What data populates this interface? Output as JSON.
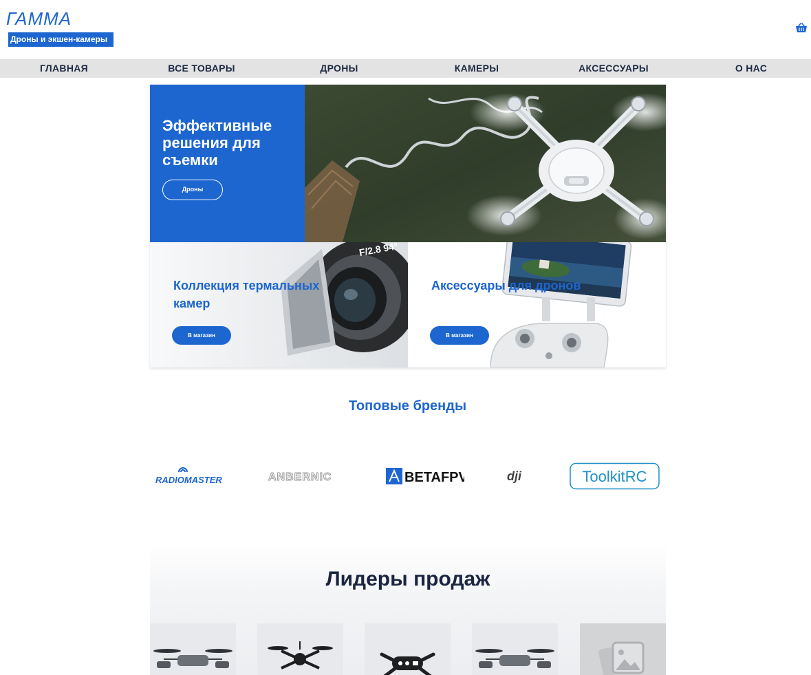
{
  "header": {
    "logo": "ГАММА",
    "tagline": "Дроны и экшен-камеры",
    "cart_icon": "basket-icon"
  },
  "nav": {
    "items": [
      {
        "label": "ГЛАВНАЯ"
      },
      {
        "label": "ВСЕ ТОВАРЫ"
      },
      {
        "label": "ДРОНЫ"
      },
      {
        "label": "КАМЕРЫ"
      },
      {
        "label": "АКСЕССУАРЫ"
      },
      {
        "label": "О НАС"
      }
    ]
  },
  "hero": {
    "title": "Эффективные решения для съемки",
    "button": "Дроны"
  },
  "cards": [
    {
      "title": "Коллекция термальных камер",
      "button": "В магазин"
    },
    {
      "title": "Аксессуары для дронов",
      "button": "В магазин"
    }
  ],
  "brands": {
    "title": "Топовые бренды",
    "logos": [
      "RADIOMASTER",
      "ANBERNIC",
      "BETAFPV",
      "dji",
      "ToolkitRC"
    ]
  },
  "bestsellers": {
    "title": "Лидеры продаж"
  },
  "colors": {
    "accent": "#1d66d0",
    "nav_bg": "#e3e3e3"
  }
}
